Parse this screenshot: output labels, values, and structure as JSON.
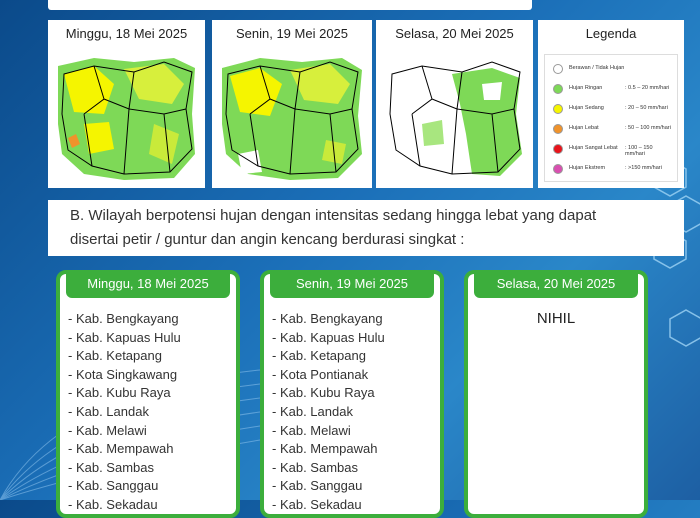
{
  "maps": [
    {
      "date": "Minggu, 18 Mei 2025"
    },
    {
      "date": "Senin, 19 Mei 2025"
    },
    {
      "date": "Selasa, 20 Mei 2025"
    }
  ],
  "legend": {
    "title": "Legenda",
    "items": [
      {
        "label": "Berawan / Tidak Hujan",
        "range": "",
        "color": "#ffffff"
      },
      {
        "label": "Hujan Ringan",
        "range": ": 0.5 – 20 mm/hari",
        "color": "#7ed957"
      },
      {
        "label": "Hujan Sedang",
        "range": ": 20 – 50 mm/hari",
        "color": "#f5f500"
      },
      {
        "label": "Hujan Lebat",
        "range": ": 50 – 100 mm/hari",
        "color": "#f0932b"
      },
      {
        "label": "Hujan Sangat Lebat",
        "range": ": 100 – 150 mm/hari",
        "color": "#e8141b"
      },
      {
        "label": "Hujan Ekstrem",
        "range": ": >150 mm/hari",
        "color": "#d94fb0"
      }
    ]
  },
  "section_b": {
    "line1": "B. Wilayah berpotensi hujan dengan intensitas sedang hingga lebat yang dapat",
    "line2": "disertai petir / guntur dan angin kencang berdurasi singkat :"
  },
  "cards": [
    {
      "date": "Minggu, 18 Mei 2025",
      "items": [
        "- Kab. Bengkayang",
        "- Kab. Kapuas Hulu",
        "- Kab. Ketapang",
        "- Kota Singkawang",
        "- Kab. Kubu Raya",
        "- Kab. Landak",
        "- Kab. Melawi",
        "- Kab. Mempawah",
        "- Kab. Sambas",
        "- Kab. Sanggau",
        "- Kab. Sekadau"
      ]
    },
    {
      "date": "Senin, 19 Mei 2025",
      "items": [
        "- Kab. Bengkayang",
        "- Kab. Kapuas Hulu",
        "- Kab. Ketapang",
        "- Kota Pontianak",
        "- Kab. Kubu Raya",
        "- Kab. Landak",
        "- Kab. Melawi",
        "- Kab. Mempawah",
        "- Kab. Sambas",
        "- Kab. Sanggau",
        "- Kab. Sekadau"
      ]
    },
    {
      "date": "Selasa, 20 Mei 2025",
      "note": "NIHIL"
    }
  ]
}
